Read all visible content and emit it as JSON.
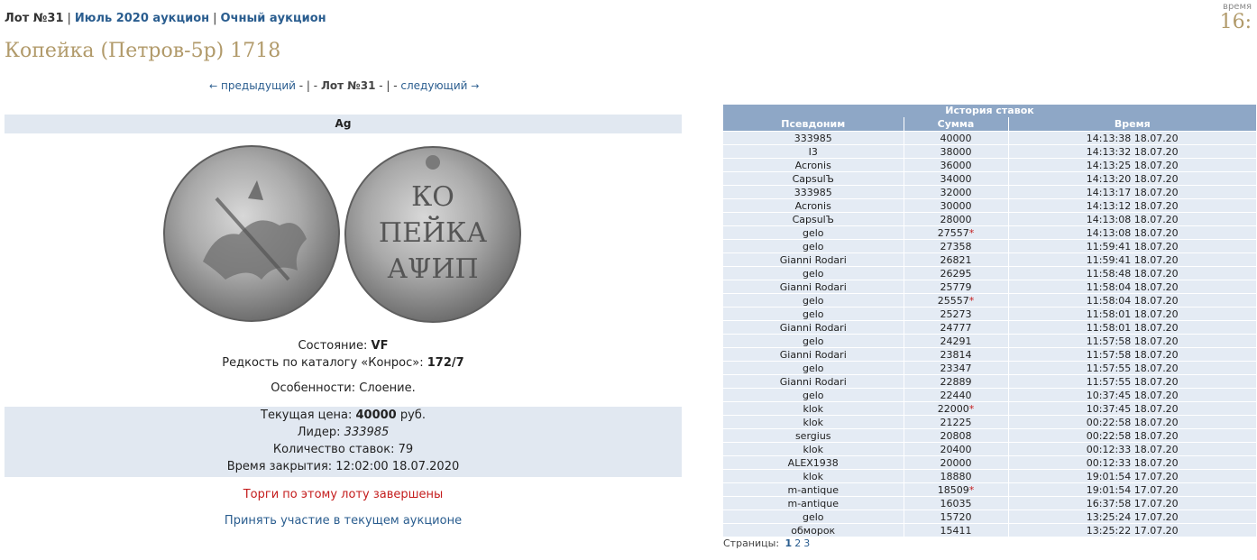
{
  "breadcrumb": {
    "lot": "Лот №31",
    "auction": "Июль 2020 аукцион",
    "type": "Очный аукцион"
  },
  "timebox": {
    "label": "время",
    "value": "16:"
  },
  "title": "Копейка (Петров-5р) 1718",
  "lot_nav": {
    "prev": "предыдущий",
    "current": "Лот №31",
    "next": "следующий"
  },
  "metal": "Ag",
  "coin": {
    "obverse_alt": "Аверс",
    "reverse_text": [
      "КО",
      "ПЕЙКА",
      "АΨИП"
    ]
  },
  "condition": {
    "label": "Состояние:",
    "value": "VF"
  },
  "rarity": {
    "label": "Редкость по каталогу «Конрос»:",
    "value": "172/7"
  },
  "features": {
    "label": "Особенности:",
    "value": "Слоение."
  },
  "current": {
    "price_label": "Текущая цена:",
    "price_value": "40000",
    "price_unit": "руб.",
    "leader_label": "Лидер:",
    "leader_value": "333985",
    "bids_label": "Количество ставок:",
    "bids_value": "79",
    "close_label": "Время закрытия:",
    "close_value": "12:02:00 18.07.2020"
  },
  "status": "Торги по этому лоту завершены",
  "join_link": "Принять участие в текущем аукционе",
  "history": {
    "caption": "История ставок",
    "columns": [
      "Псевдоним",
      "Сумма",
      "Время"
    ],
    "rows": [
      {
        "nick": "333985",
        "sum": "40000",
        "star": false,
        "time": "14:13:38 18.07.20"
      },
      {
        "nick": "I3",
        "sum": "38000",
        "star": false,
        "time": "14:13:32 18.07.20"
      },
      {
        "nick": "Acronis",
        "sum": "36000",
        "star": false,
        "time": "14:13:25 18.07.20"
      },
      {
        "nick": "CapsulЪ",
        "sum": "34000",
        "star": false,
        "time": "14:13:20 18.07.20"
      },
      {
        "nick": "333985",
        "sum": "32000",
        "star": false,
        "time": "14:13:17 18.07.20"
      },
      {
        "nick": "Acronis",
        "sum": "30000",
        "star": false,
        "time": "14:13:12 18.07.20"
      },
      {
        "nick": "CapsulЪ",
        "sum": "28000",
        "star": false,
        "time": "14:13:08 18.07.20"
      },
      {
        "nick": "gelo",
        "sum": "27557",
        "star": true,
        "time": "14:13:08 18.07.20"
      },
      {
        "nick": "gelo",
        "sum": "27358",
        "star": false,
        "time": "11:59:41 18.07.20"
      },
      {
        "nick": "Gianni Rodari",
        "sum": "26821",
        "star": false,
        "time": "11:59:41 18.07.20"
      },
      {
        "nick": "gelo",
        "sum": "26295",
        "star": false,
        "time": "11:58:48 18.07.20"
      },
      {
        "nick": "Gianni Rodari",
        "sum": "25779",
        "star": false,
        "time": "11:58:04 18.07.20"
      },
      {
        "nick": "gelo",
        "sum": "25557",
        "star": true,
        "time": "11:58:04 18.07.20"
      },
      {
        "nick": "gelo",
        "sum": "25273",
        "star": false,
        "time": "11:58:01 18.07.20"
      },
      {
        "nick": "Gianni Rodari",
        "sum": "24777",
        "star": false,
        "time": "11:58:01 18.07.20"
      },
      {
        "nick": "gelo",
        "sum": "24291",
        "star": false,
        "time": "11:57:58 18.07.20"
      },
      {
        "nick": "Gianni Rodari",
        "sum": "23814",
        "star": false,
        "time": "11:57:58 18.07.20"
      },
      {
        "nick": "gelo",
        "sum": "23347",
        "star": false,
        "time": "11:57:55 18.07.20"
      },
      {
        "nick": "Gianni Rodari",
        "sum": "22889",
        "star": false,
        "time": "11:57:55 18.07.20"
      },
      {
        "nick": "gelo",
        "sum": "22440",
        "star": false,
        "time": "10:37:45 18.07.20"
      },
      {
        "nick": "klok",
        "sum": "22000",
        "star": true,
        "time": "10:37:45 18.07.20"
      },
      {
        "nick": "klok",
        "sum": "21225",
        "star": false,
        "time": "00:22:58 18.07.20"
      },
      {
        "nick": "sergius",
        "sum": "20808",
        "star": false,
        "time": "00:22:58 18.07.20"
      },
      {
        "nick": "klok",
        "sum": "20400",
        "star": false,
        "time": "00:12:33 18.07.20"
      },
      {
        "nick": "ALEX1938",
        "sum": "20000",
        "star": false,
        "time": "00:12:33 18.07.20"
      },
      {
        "nick": "klok",
        "sum": "18880",
        "star": false,
        "time": "19:01:54 17.07.20"
      },
      {
        "nick": "m-antique",
        "sum": "18509",
        "star": true,
        "time": "19:01:54 17.07.20"
      },
      {
        "nick": "m-antique",
        "sum": "16035",
        "star": false,
        "time": "16:37:58 17.07.20"
      },
      {
        "nick": "gelo",
        "sum": "15720",
        "star": false,
        "time": "13:25:24 17.07.20"
      },
      {
        "nick": "обморок",
        "sum": "15411",
        "star": false,
        "time": "13:25:22 17.07.20"
      }
    ],
    "star_symbol": "*"
  },
  "pages": {
    "label": "Страницы:",
    "items": [
      "1",
      "2",
      "3"
    ],
    "active": "1"
  }
}
